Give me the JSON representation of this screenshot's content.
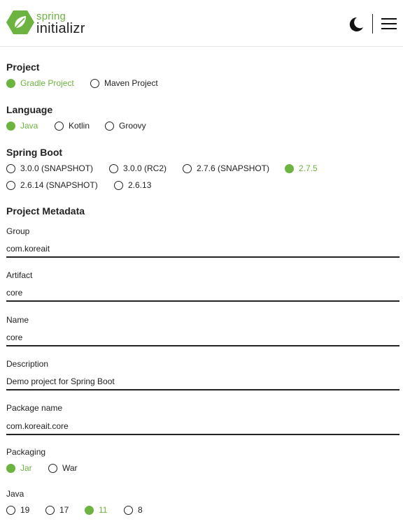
{
  "header": {
    "brand_top": "spring",
    "brand_bottom": "initializr",
    "theme_icon": "moon-icon",
    "menu_icon": "hamburger-menu-icon",
    "brand_color": "#6db33f"
  },
  "project": {
    "title": "Project",
    "options": [
      "Gradle Project",
      "Maven Project"
    ],
    "selected": "Gradle Project"
  },
  "language": {
    "title": "Language",
    "options": [
      "Java",
      "Kotlin",
      "Groovy"
    ],
    "selected": "Java"
  },
  "spring_boot": {
    "title": "Spring Boot",
    "options": [
      "3.0.0 (SNAPSHOT)",
      "3.0.0 (RC2)",
      "2.7.6 (SNAPSHOT)",
      "2.7.5",
      "2.6.14 (SNAPSHOT)",
      "2.6.13"
    ],
    "selected": "2.7.5"
  },
  "metadata": {
    "title": "Project Metadata",
    "fields": [
      {
        "label": "Group",
        "value": "com.koreait"
      },
      {
        "label": "Artifact",
        "value": "core"
      },
      {
        "label": "Name",
        "value": "core"
      },
      {
        "label": "Description",
        "value": "Demo project for Spring Boot"
      },
      {
        "label": "Package name",
        "value": "com.koreait.core"
      }
    ],
    "packaging": {
      "label": "Packaging",
      "options": [
        "Jar",
        "War"
      ],
      "selected": "Jar"
    },
    "java": {
      "label": "Java",
      "options": [
        "19",
        "17",
        "11",
        "8"
      ],
      "selected": "11"
    }
  }
}
